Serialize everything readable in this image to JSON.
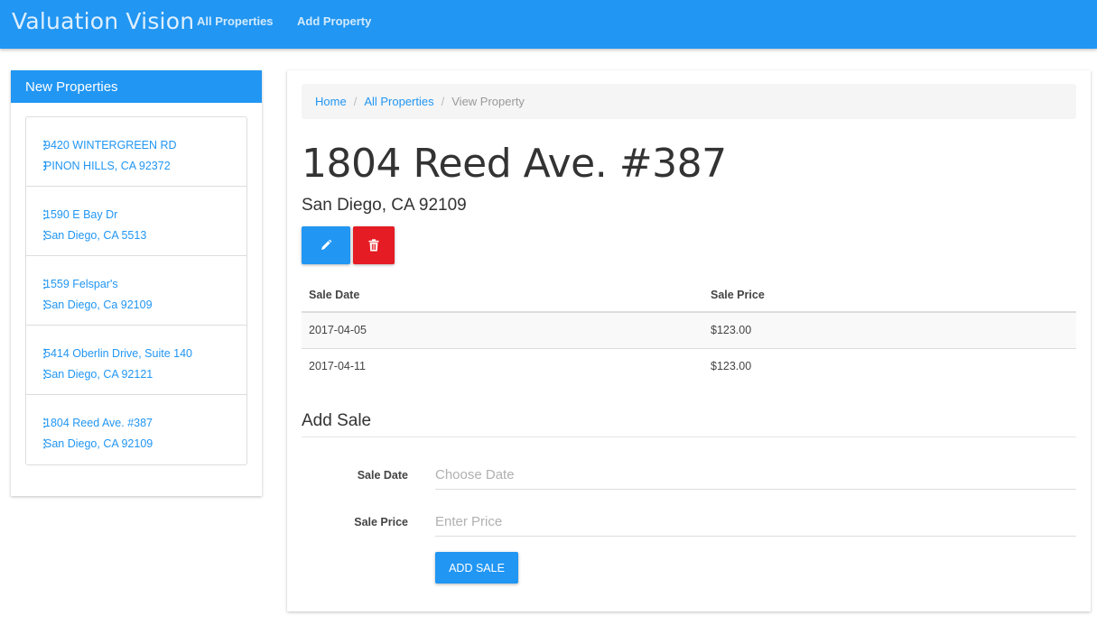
{
  "navbar": {
    "brand": "Valuation Vision",
    "links": [
      "All Properties",
      "Add Property"
    ]
  },
  "sidebar": {
    "heading": "New Properties",
    "items": [
      {
        "street": "9420 WINTERGREEN RD",
        "city": "PINON HILLS, CA 92372"
      },
      {
        "street": "1590 E Bay Dr",
        "city": "San Diego, CA 5513"
      },
      {
        "street": "1559 Felspar's",
        "city": "San Diego, Ca 92109"
      },
      {
        "street": "5414 Oberlin Drive, Suite 140",
        "city": "San Diego, CA 92121"
      },
      {
        "street": "1804 Reed Ave. #387",
        "city": "San Diego, CA 92109"
      }
    ]
  },
  "breadcrumb": {
    "home": "Home",
    "all": "All Properties",
    "current": "View Property",
    "separator": "/"
  },
  "property": {
    "title": "1804 Reed Ave. #387",
    "subtitle": "San Diego, CA 92109"
  },
  "actions": {
    "edit_icon": "pencil-icon",
    "delete_icon": "trash-icon"
  },
  "sales_table": {
    "headers": [
      "Sale Date",
      "Sale Price"
    ],
    "rows": [
      [
        "2017-04-05",
        "$123.00"
      ],
      [
        "2017-04-11",
        "$123.00"
      ]
    ]
  },
  "add_sale": {
    "heading": "Add Sale",
    "date_label": "Sale Date",
    "date_placeholder": "Choose Date",
    "price_label": "Sale Price",
    "price_placeholder": "Enter Price",
    "submit_label": "ADD SALE"
  },
  "colors": {
    "primary": "#2196f3",
    "danger": "#e51c23"
  }
}
